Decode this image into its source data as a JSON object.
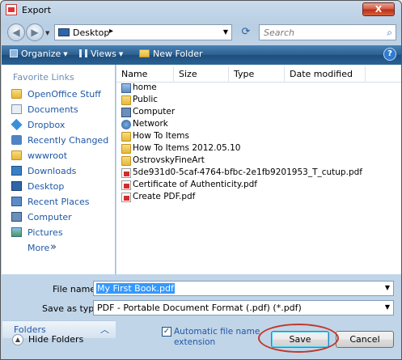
{
  "window": {
    "title": "Export",
    "close_label": "X"
  },
  "address": {
    "location": "Desktop",
    "separator": "▸",
    "search_placeholder": "Search"
  },
  "toolbar": {
    "organize": "Organize",
    "views": "Views",
    "new_folder": "New Folder",
    "help": "?"
  },
  "sidebar": {
    "heading": "Favorite Links",
    "items": [
      {
        "label": "OpenOffice Stuff",
        "icon": "folder-icon"
      },
      {
        "label": "Documents",
        "icon": "documents-icon"
      },
      {
        "label": "Dropbox",
        "icon": "dropbox-icon"
      },
      {
        "label": "Recently Changed",
        "icon": "recent-icon"
      },
      {
        "label": "wwwroot",
        "icon": "folder-icon"
      },
      {
        "label": "Downloads",
        "icon": "downloads-icon"
      },
      {
        "label": "Desktop",
        "icon": "desktop-icon"
      },
      {
        "label": "Recent Places",
        "icon": "recent-places-icon"
      },
      {
        "label": "Computer",
        "icon": "computer-icon"
      },
      {
        "label": "Pictures",
        "icon": "pictures-icon"
      }
    ],
    "more": "More",
    "more_chevron": "»",
    "folders": "Folders",
    "folders_chevron": "︿"
  },
  "columns": [
    "Name",
    "Size",
    "Type",
    "Date modified"
  ],
  "files": [
    {
      "name": "home",
      "icon": "home"
    },
    {
      "name": "Public",
      "icon": "folder"
    },
    {
      "name": "Computer",
      "icon": "comp"
    },
    {
      "name": "Network",
      "icon": "net"
    },
    {
      "name": "How To Items",
      "icon": "folder"
    },
    {
      "name": "How To Items 2012.05.10",
      "icon": "folder"
    },
    {
      "name": "OstrovskyFineArt",
      "icon": "folder"
    },
    {
      "name": "5de931d0-5caf-4764-bfbc-2e1fb9201953_T_cutup.pdf",
      "icon": "pdf"
    },
    {
      "name": "Certificate of Authenticity.pdf",
      "icon": "pdf"
    },
    {
      "name": "Create PDF.pdf",
      "icon": "pdf"
    }
  ],
  "form": {
    "file_name_label": "File name:",
    "file_name_value": "My First Book.pdf",
    "save_as_label": "Save as type:",
    "save_as_value": "PDF - Portable Document Format (.pdf) (*.pdf)"
  },
  "footer": {
    "hide_folders": "Hide Folders",
    "auto_ext_line1": "Automatic file name",
    "auto_ext_line2": "extension",
    "auto_ext_checked": true,
    "save": "Save",
    "cancel": "Cancel"
  }
}
